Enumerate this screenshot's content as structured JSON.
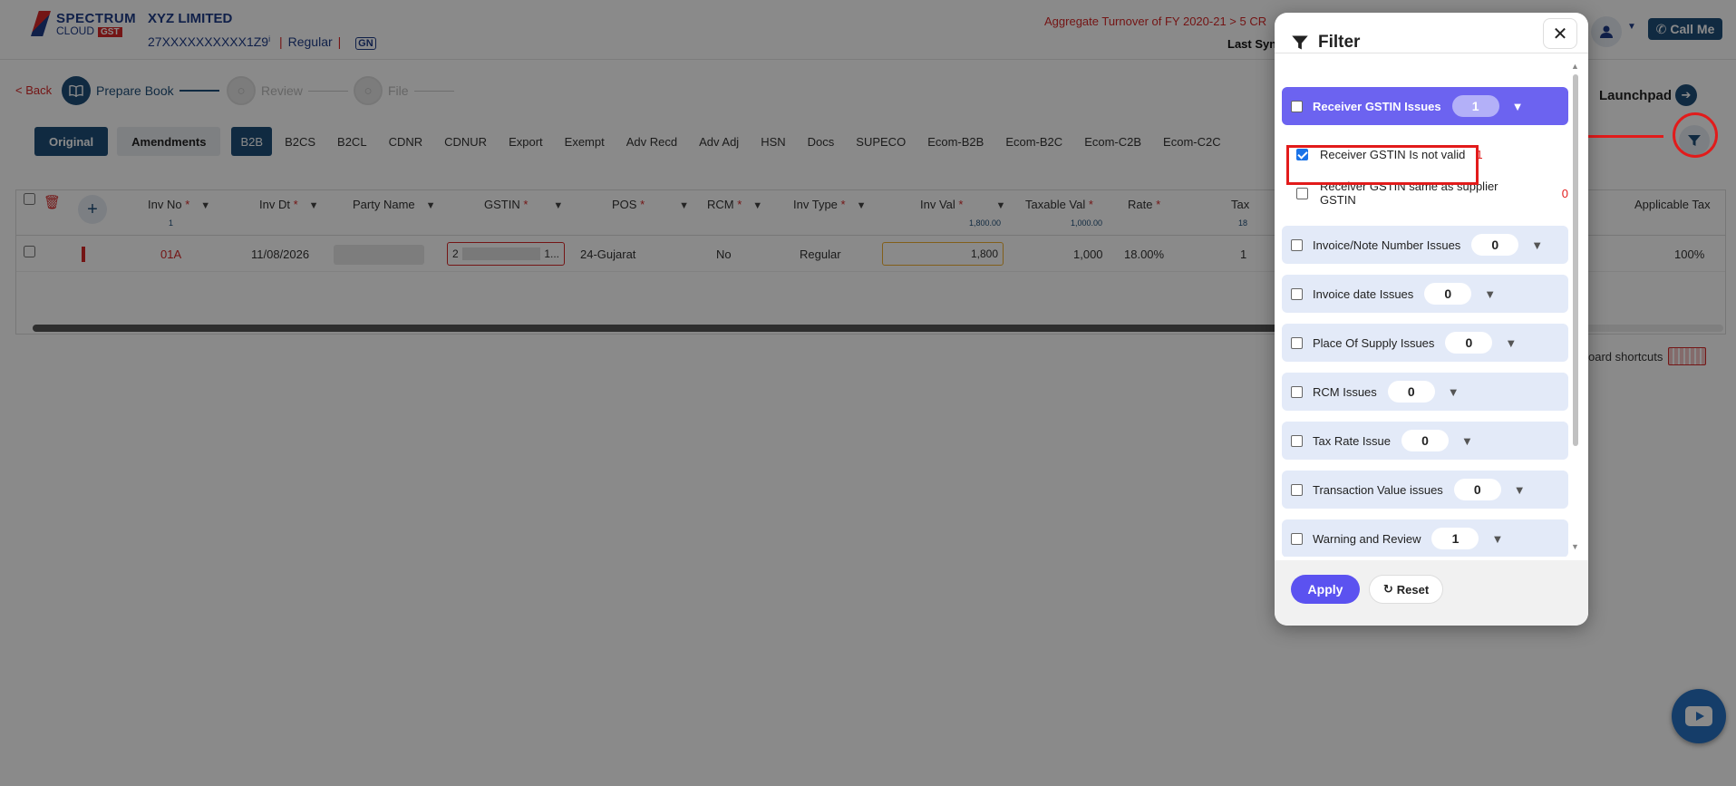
{
  "header": {
    "logo_line1": "SPECTRUM",
    "logo_line2": "CLOUD",
    "logo_badge": "GST",
    "company": "XYZ LIMITED",
    "gstin": "27XXXXXXXXXX1Z9",
    "info_mark": "i",
    "sep": "|",
    "type": "Regular",
    "gn_logo": "GN",
    "turnover": "Aggregate Turnover of FY 2020-21 > 5 CR",
    "last_sync": "Last Sync",
    "call_me": "Call Me"
  },
  "stepper": {
    "back": "< Back",
    "steps": [
      "Prepare Book",
      "Review",
      "File"
    ]
  },
  "launchpad": "Launchpad",
  "tabs": {
    "original": "Original",
    "amendments": "Amendments",
    "sections": [
      "B2B",
      "B2CS",
      "B2CL",
      "CDNR",
      "CDNUR",
      "Export",
      "Exempt",
      "Adv Recd",
      "Adv Adj",
      "HSN",
      "Docs",
      "SUPECO",
      "Ecom-B2B",
      "Ecom-B2C",
      "Ecom-C2B",
      "Ecom-C2C"
    ],
    "active": "B2B"
  },
  "grid": {
    "columns": [
      "Inv No",
      "Inv Dt",
      "Party Name",
      "GSTIN",
      "POS",
      "RCM",
      "Inv Type",
      "Inv Val",
      "Taxable Val",
      "Rate",
      "Tax",
      "Applicable Tax"
    ],
    "required_mark": "*",
    "subtotals": {
      "inv_no": "1",
      "inv_val": "1,800.00",
      "taxable_val": "1,000.00",
      "tax": "18"
    },
    "row": {
      "inv_no": "01A",
      "inv_dt": "11/08/2026",
      "gstin_start": "2",
      "gstin_end": "1...",
      "pos": "24-Gujarat",
      "rcm": "No",
      "inv_type": "Regular",
      "inv_val": "1,800",
      "taxable_val": "1,000",
      "rate": "18.00%",
      "tax": "1",
      "applicable_tax": "100%"
    },
    "keyboard_shortcuts": "oard shortcuts"
  },
  "filter": {
    "title": "Filter",
    "close": "✕",
    "groups": [
      {
        "label": "Receiver GSTIN Issues",
        "count": "1",
        "active": true
      },
      {
        "label": "Invoice/Note Number Issues",
        "count": "0"
      },
      {
        "label": "Invoice date Issues",
        "count": "0"
      },
      {
        "label": "Place Of Supply Issues",
        "count": "0"
      },
      {
        "label": "RCM Issues",
        "count": "0"
      },
      {
        "label": "Tax Rate Issue",
        "count": "0"
      },
      {
        "label": "Transaction Value issues",
        "count": "0"
      },
      {
        "label": "Warning and Review",
        "count": "1"
      }
    ],
    "sub_items": [
      {
        "label": "Receiver GSTIN Is not valid",
        "count": "1",
        "checked": true
      },
      {
        "label": "Receiver GSTIN same as supplier GSTIN",
        "count": "0",
        "checked": false
      }
    ],
    "apply": "Apply",
    "reset": "Reset"
  },
  "colors": {
    "primary": "#1f4e79",
    "accent": "#6c63f0",
    "highlight": "#e21b1b",
    "group_bg": "#e3eaf8"
  },
  "icons": [
    "filter-icon",
    "close-icon",
    "user-icon",
    "phone-icon",
    "book-icon",
    "arrow-right-icon",
    "add-icon",
    "delete-icon",
    "reset-icon",
    "youtube-icon"
  ]
}
